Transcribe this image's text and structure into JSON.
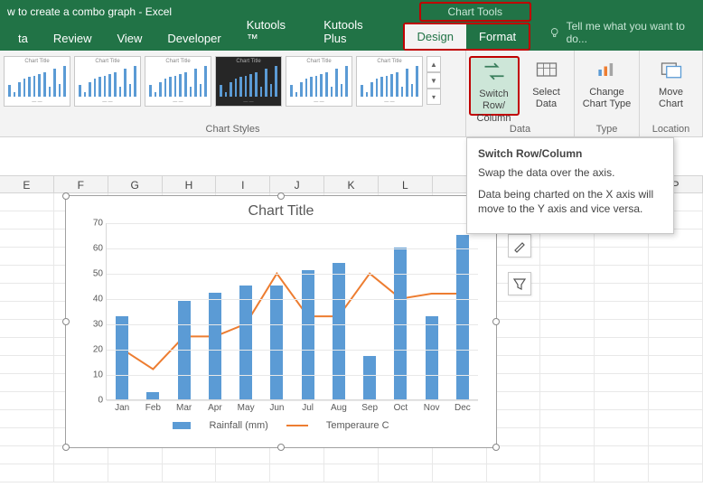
{
  "titlebar": {
    "text": "w to create a combo graph - Excel",
    "chart_tools": "Chart Tools"
  },
  "tabs": {
    "items": [
      "ta",
      "Review",
      "View",
      "Developer",
      "Kutools ™",
      "Kutools Plus"
    ],
    "sub": [
      "Design",
      "Format"
    ],
    "tellme": "Tell me what you want to do..."
  },
  "ribbon": {
    "styles_label": "Chart Styles",
    "data_label": "Data",
    "type_label": "Type",
    "location_label": "Location",
    "switch": "Switch Row/\nColumn",
    "select": "Select\nData",
    "change": "Change\nChart Type",
    "move": "Move\nChart",
    "thumb_title": "Chart Title"
  },
  "tooltip": {
    "title": "Switch Row/Column",
    "p1": "Swap the data over the axis.",
    "p2": "Data being charted on the X axis will move to the Y axis and vice versa."
  },
  "cols": [
    "E",
    "F",
    "G",
    "H",
    "I",
    "J",
    "K",
    "L",
    "",
    "",
    "",
    "",
    "P"
  ],
  "chart_data": {
    "type": "combo",
    "title": "Chart Title",
    "categories": [
      "Jan",
      "Feb",
      "Mar",
      "Apr",
      "May",
      "Jun",
      "Jul",
      "Aug",
      "Sep",
      "Oct",
      "Nov",
      "Dec"
    ],
    "ylim": [
      0,
      70
    ],
    "yticks": [
      0,
      10,
      20,
      30,
      40,
      50,
      60,
      70
    ],
    "series": [
      {
        "name": "Rainfall (mm)",
        "type": "bar",
        "color": "#5b9bd5",
        "values": [
          33,
          3,
          39,
          42,
          45,
          45,
          51,
          54,
          17,
          60,
          33,
          65
        ]
      },
      {
        "name": "Temperaure C",
        "type": "line",
        "color": "#ed7d31",
        "values": [
          20,
          12,
          25,
          25,
          30,
          50,
          33,
          33,
          50,
          40,
          42,
          42
        ]
      }
    ]
  }
}
